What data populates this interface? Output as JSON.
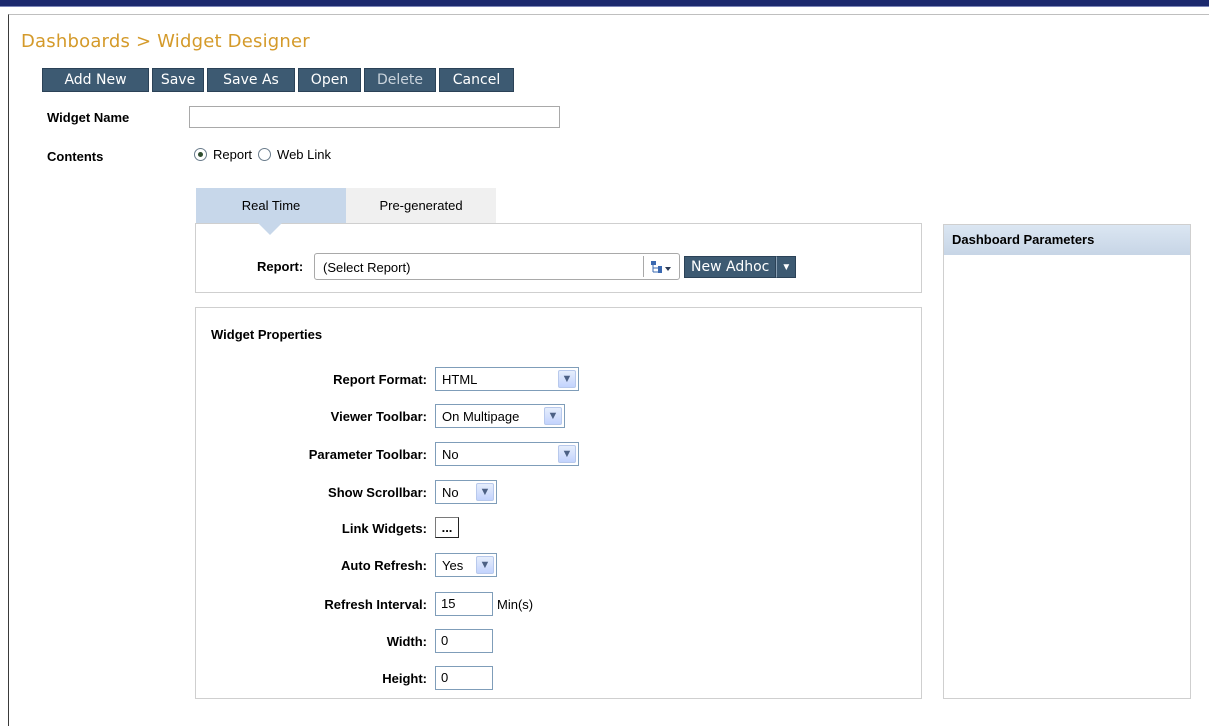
{
  "breadcrumb": "Dashboards > Widget Designer",
  "toolbar": {
    "add_new": "Add New",
    "save": "Save",
    "save_as": "Save As",
    "open": "Open",
    "delete": "Delete",
    "cancel": "Cancel"
  },
  "form": {
    "widget_name_label": "Widget Name",
    "widget_name_value": "",
    "contents_label": "Contents",
    "contents_options": [
      "Report",
      "Web Link"
    ],
    "contents_selected": "Report"
  },
  "tabs": [
    {
      "label": "Real Time",
      "active": true
    },
    {
      "label": "Pre-generated",
      "active": false
    }
  ],
  "report": {
    "label": "Report:",
    "value": "(Select Report)",
    "new_adhoc": "New Adhoc"
  },
  "dashboard_parameters": {
    "title": "Dashboard Parameters"
  },
  "widget_properties": {
    "title": "Widget Properties",
    "report_format_label": "Report Format:",
    "report_format_value": "HTML",
    "viewer_toolbar_label": "Viewer Toolbar:",
    "viewer_toolbar_value": "On Multipage",
    "parameter_toolbar_label": "Parameter Toolbar:",
    "parameter_toolbar_value": "No",
    "show_scrollbar_label": "Show Scrollbar:",
    "show_scrollbar_value": "No",
    "link_widgets_label": "Link Widgets:",
    "link_widgets_button": "...",
    "auto_refresh_label": "Auto Refresh:",
    "auto_refresh_value": "Yes",
    "refresh_interval_label": "Refresh Interval:",
    "refresh_interval_value": "15",
    "refresh_interval_unit": "Min(s)",
    "width_label": "Width:",
    "width_value": "0",
    "height_label": "Height:",
    "height_value": "0"
  },
  "colors": {
    "accent": "#d49a2a",
    "button_bg": "#3d5a72",
    "tab_active": "#c7d7ea",
    "top_bar": "#1c2a6e"
  }
}
